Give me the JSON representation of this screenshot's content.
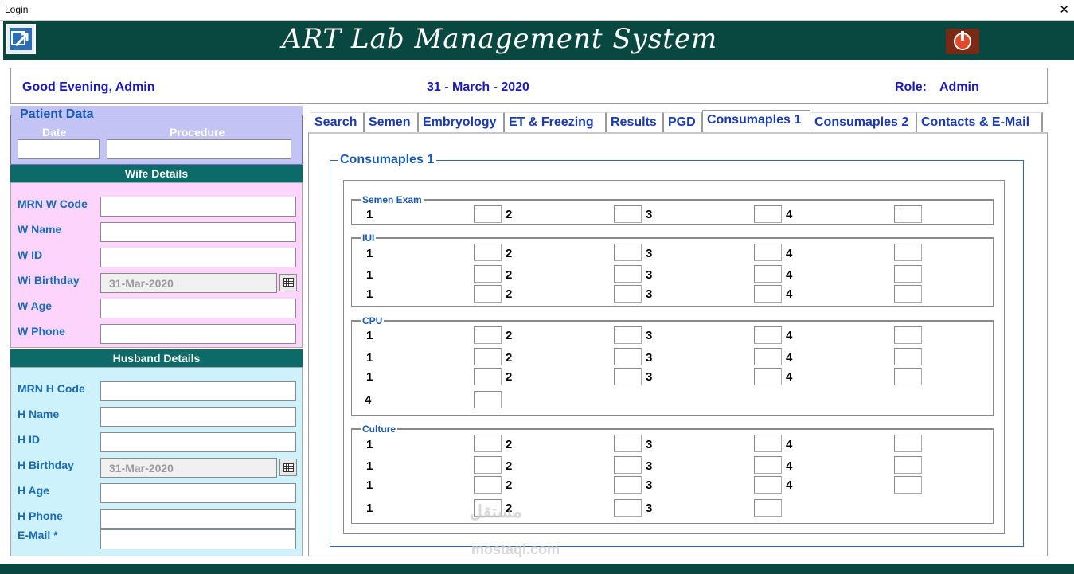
{
  "window": {
    "title": "Login",
    "close_glyph": "✕"
  },
  "header": {
    "app_title": "ART Lab Management System",
    "logo_icon": "app-logo-icon",
    "power_icon": "power-icon"
  },
  "infobar": {
    "greeting": "Good Evening, Admin",
    "date": "31 - March - 2020",
    "role_label": "Role:",
    "role_value": "Admin"
  },
  "patient": {
    "legend": "Patient Data",
    "date_label": "Date",
    "procedure_label": "Procedure",
    "date_value": "",
    "procedure_value": ""
  },
  "wife": {
    "header": "Wife Details",
    "fields": [
      {
        "label": "MRN W Code",
        "value": ""
      },
      {
        "label": "W Name",
        "value": ""
      },
      {
        "label": "W ID",
        "value": ""
      },
      {
        "label": "Wi Birthday",
        "value": "31-Mar-2020"
      },
      {
        "label": "W Age",
        "value": ""
      },
      {
        "label": "W Phone",
        "value": ""
      }
    ]
  },
  "husband": {
    "header": "Husband Details",
    "fields": [
      {
        "label": "MRN H Code",
        "value": ""
      },
      {
        "label": "H Name",
        "value": ""
      },
      {
        "label": "H ID",
        "value": ""
      },
      {
        "label": "H Birthday",
        "value": "31-Mar-2020"
      },
      {
        "label": "H Age",
        "value": ""
      },
      {
        "label": "H Phone",
        "value": ""
      },
      {
        "label": "E-Mail *",
        "value": ""
      }
    ]
  },
  "tabs": [
    "Search",
    "Semen",
    "Embryology",
    "ET & Freezing",
    "Results",
    "PGD",
    "Consumaples 1",
    "Consumaples 2",
    "Contacts & E-Mail"
  ],
  "active_tab": "Consumaples 1",
  "consumables": {
    "legend": "Consumaples 1",
    "groups": [
      {
        "name": "Semen Exam",
        "rows": [
          [
            "1",
            "2",
            "3",
            "4"
          ]
        ]
      },
      {
        "name": "IUI",
        "rows": [
          [
            "1",
            "2",
            "3",
            "4"
          ],
          [
            "1",
            "2",
            "3",
            "4"
          ],
          [
            "1",
            "2",
            "3",
            "4"
          ]
        ]
      },
      {
        "name": "CPU",
        "rows": [
          [
            "1",
            "2",
            "3",
            "4"
          ],
          [
            "1",
            "2",
            "3",
            "4"
          ],
          [
            "1",
            "2",
            "3",
            "4"
          ],
          [
            "4"
          ]
        ]
      },
      {
        "name": "Culture",
        "rows": [
          [
            "1",
            "2",
            "3",
            "4"
          ],
          [
            "1",
            "2",
            "3",
            "4"
          ],
          [
            "1",
            "2",
            "3",
            "4"
          ],
          [
            "1",
            "2",
            "3"
          ]
        ]
      }
    ]
  },
  "watermark": {
    "arabic": "مستقل",
    "latin": "mostaql.com"
  },
  "colors": {
    "header_bg": "#094840",
    "accent_blue": "#1a3ab4",
    "wife_bg": "#fcd4fc",
    "husband_bg": "#cef2fc",
    "patient_bg": "#c4c4f4"
  }
}
